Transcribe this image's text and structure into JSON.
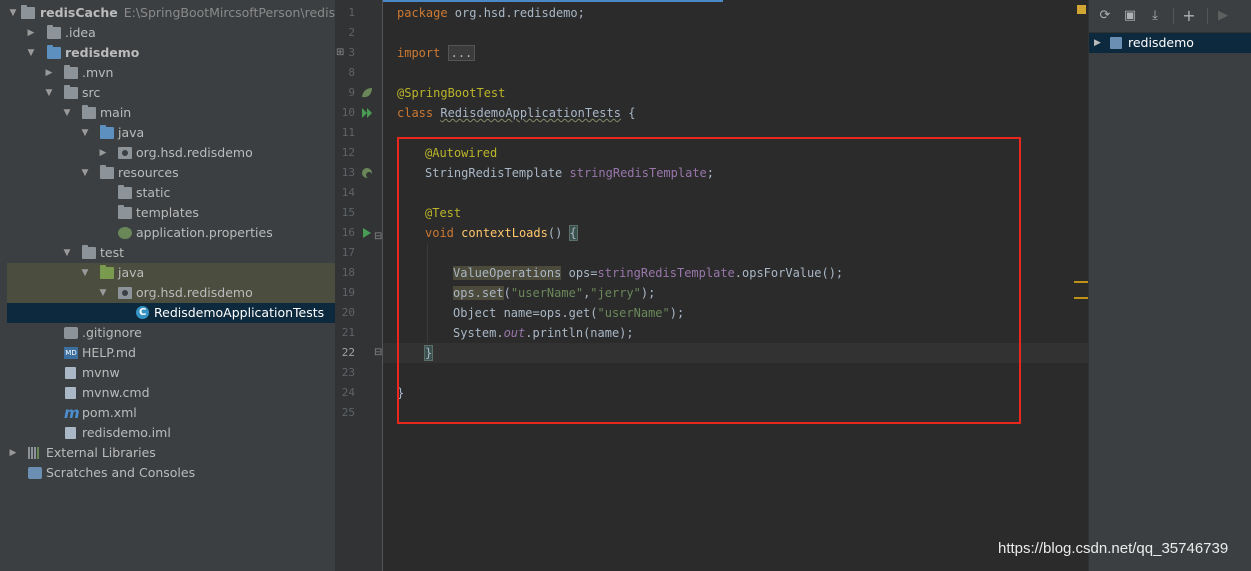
{
  "project": {
    "rows": [
      {
        "label": "redisCache",
        "path": "E:\\SpringBootMircsoftPerson\\redisCa"
      },
      {
        "label": ".idea"
      },
      {
        "label": "redisdemo"
      },
      {
        "label": ".mvn"
      },
      {
        "label": "src"
      },
      {
        "label": "main"
      },
      {
        "label": "java"
      },
      {
        "label": "org.hsd.redisdemo"
      },
      {
        "label": "resources"
      },
      {
        "label": "static"
      },
      {
        "label": "templates"
      },
      {
        "label": "application.properties"
      },
      {
        "label": "test"
      },
      {
        "label": "java"
      },
      {
        "label": "org.hsd.redisdemo"
      },
      {
        "label": "RedisdemoApplicationTests"
      },
      {
        "label": ".gitignore"
      },
      {
        "label": "HELP.md"
      },
      {
        "label": "mvnw"
      },
      {
        "label": "mvnw.cmd"
      },
      {
        "label": "pom.xml"
      },
      {
        "label": "redisdemo.iml"
      },
      {
        "label": "External Libraries"
      },
      {
        "label": "Scratches and Consoles"
      }
    ],
    "md_icon_text": "MD",
    "m_icon_text": "m"
  },
  "editor": {
    "line_numbers": [
      "1",
      "2",
      "3",
      "8",
      "9",
      "10",
      "11",
      "12",
      "13",
      "14",
      "15",
      "16",
      "17",
      "18",
      "19",
      "20",
      "21",
      "22",
      "23",
      "24",
      "25"
    ],
    "t": {
      "package": "package",
      "pkgname": " org.hsd.redisdemo;",
      "import": "import",
      "importdots": "...",
      "ann_sbt": "@SpringBootTest",
      "class": "class",
      "classname": "RedisdemoApplicationTests",
      "classrest": " {",
      "ann_aw": "@Autowired",
      "srt_type": "StringRedisTemplate ",
      "srt_field": "stringRedisTemplate",
      "semi": ";",
      "ann_test": "@Test",
      "void": "void",
      "method": "contextLoads",
      "parens": "() ",
      "lbrace": "{",
      "vo_type": "ValueOperations",
      "vo_rest": " ops=",
      "vo_field": "stringRedisTemplate",
      "vo_call": ".opsForValue();",
      "ops_set": "ops.set",
      "set_open": "(",
      "s_user": "\"userName\"",
      "comma": ",",
      "s_jerry": "\"jerry\"",
      "set_close": ");",
      "obj_decl": "Object name=ops.get(",
      "s_user2": "\"userName\"",
      "obj_close": ");",
      "sys": "System.",
      "out": "out",
      "println": ".println(name);",
      "rbrace": "}",
      "classend": "}"
    }
  },
  "maven": {
    "project": "redisdemo",
    "tool_icons": [
      "refresh-icon",
      "reimport-icon",
      "download-icon",
      "add-icon",
      "run-icon"
    ]
  },
  "watermark": "https://blog.csdn.net/qq_35746739",
  "colors": {
    "keyword": "#cc7832",
    "annotation": "#bbb529",
    "string": "#6a8759",
    "field": "#9876aa",
    "method": "#ffc66d",
    "default_text": "#a9b7c6",
    "selection": "#0d293e",
    "highlight_box": "#e8281f"
  }
}
